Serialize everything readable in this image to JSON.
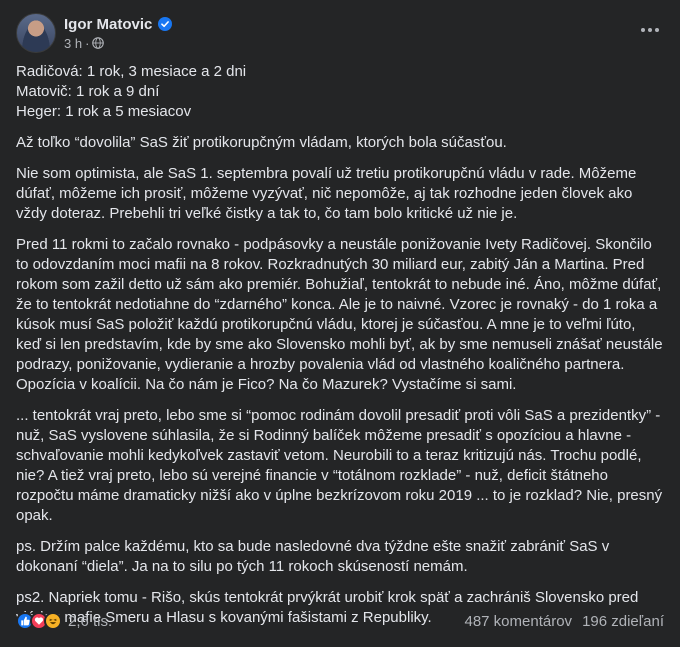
{
  "author": {
    "name": "Igor Matovic",
    "time": "3 h",
    "separator": "·"
  },
  "paragraphs": [
    "Radičová: 1 rok, 3 mesiace a 2 dni\nMatovič: 1 rok a 9 dní\nHeger: 1 rok a 5 mesiacov",
    "Až toľko “dovolila” SaS žiť protikorupčným vládam, ktorých bola súčasťou.",
    "Nie som optimista, ale SaS 1. septembra povalí už tretiu protikorupčnú vládu v rade. Môžeme dúfať, môžeme ich prosiť, môžeme vyzývať, nič nepomôže, aj tak rozhodne jeden človek ako vždy doteraz. Prebehli tri veľké čistky a tak to, čo tam bolo kritické už nie je.",
    "Pred 11 rokmi to začalo rovnako - podpásovky a neustále ponižovanie Ivety Radičovej. Skončilo to odovzdaním moci mafii na 8 rokov. Rozkradnutých 30 miliard eur, zabitý Ján a Martina. Pred rokom som zažil detto už sám ako premiér. Bohužiaľ, tentokrát to nebude iné. Áno, môžme dúfať, že to tentokrát nedotiahne do “zdarného” konca. Ale je to naivné. Vzorec je rovnaký - do 1 roka a kúsok musí SaS položiť každú protikorupčnú vládu, ktorej je súčasťou. A mne je to veľmi ľúto, keď si len predstavím, kde by sme ako Slovensko mohli byť, ak by sme nemuseli znášať neustále podrazy, ponižovanie, vydieranie a hrozby povalenia vlád od vlastného koaličného partnera. Opozícia v koalícii. Na čo nám je Fico? Na čo Mazurek? Vystačíme si sami.",
    "... tentokrát vraj preto, lebo sme si “pomoc rodinám dovolil presadiť proti vôli SaS a prezidentky” - nuž, SaS vyslovene súhlasila, že si Rodinný balíček môžeme presadiť s opozíciou a hlavne - schvaľovanie mohli kedykoľvek zastaviť vetom. Neurobili to a teraz kritizujú nás. Trochu podlé, nie? A tiež vraj preto, lebo sú verejné financie v “totálnom rozklade” - nuž, deficit štátneho rozpočtu máme dramaticky nižší ako v úplne bezkrízovom roku 2019 ... to je rozklad? Nie, presný opak.",
    "ps. Držím palce každému, kto sa bude nasledovné dva týždne ešte snažiť zabrániť SaS v dokonaní “diela”. Ja na to silu po tých 11 rokoch skúseností nemám.",
    "ps2. Napriek tomu - Rišo, skús tentokrát prvýkrát urobiť krok späť a zachrániš Slovensko pred vládou mafie Smeru a Hlasu s kovanými fašistami z Republiky."
  ],
  "footer": {
    "reaction_count": "2,6 tis.",
    "comments": "487 komentárov",
    "shares": "196 zdieľaní"
  }
}
